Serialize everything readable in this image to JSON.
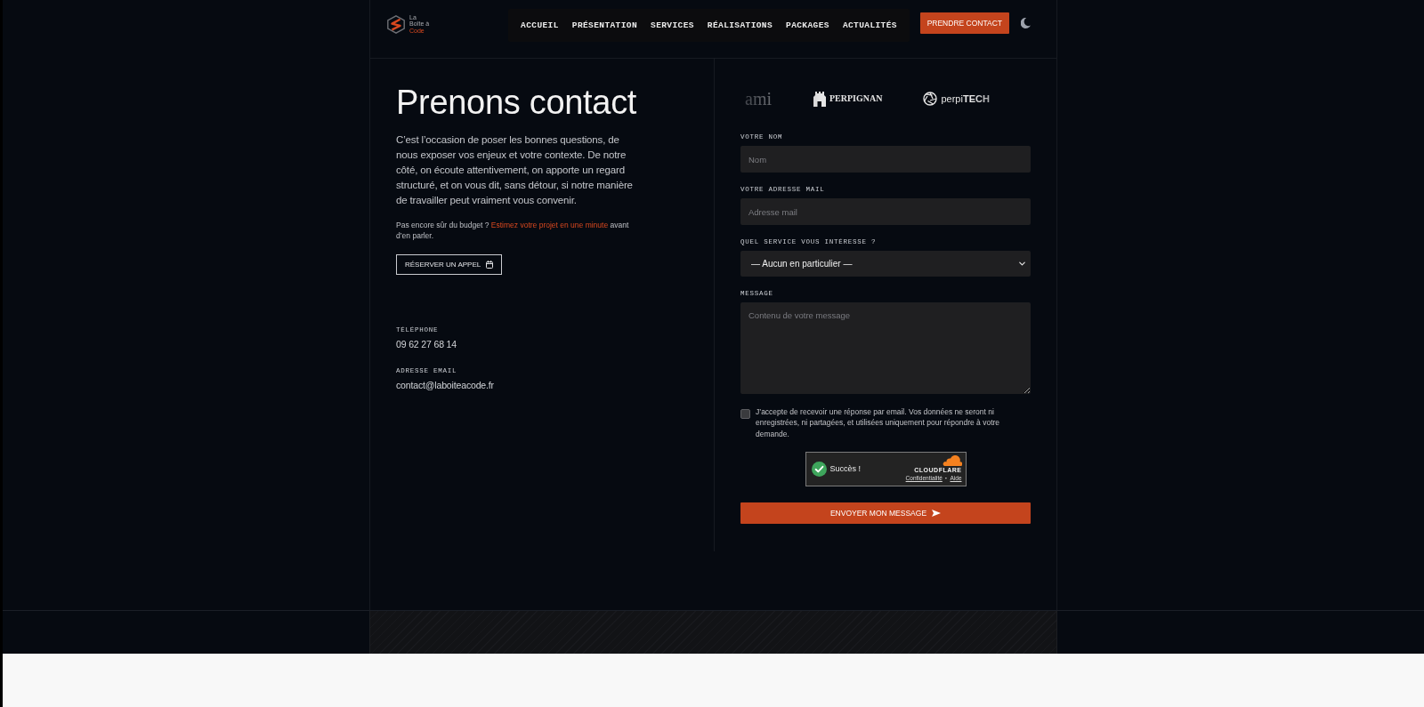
{
  "header": {
    "logo": {
      "lines": [
        "La",
        "Boîte à",
        "Code"
      ]
    },
    "nav": [
      {
        "label": "ACCUEIL",
        "selected": false
      },
      {
        "label": "PRÉSENTATION",
        "selected": false
      },
      {
        "label": "SERVICES",
        "selected": false
      },
      {
        "label": "RÉALISATIONS",
        "selected": false
      },
      {
        "label": "PACKAGES",
        "selected": false
      },
      {
        "label": "ACTUALITÉS",
        "selected": false
      }
    ],
    "cta": "PRENDRE CONTACT"
  },
  "intro": {
    "title": "Prenons contact",
    "text": "C’est l’occasion de poser les bonnes questions, de nous exposer vos enjeux et votre contexte. De notre côté, on écoute attentivement, on apporte un regard structuré, et on vous dit, sans détour, si notre manière de travailler peut vraiment vous convenir.",
    "budget_note": {
      "before": "Pas encore sûr du budget ?",
      "link": "Estimez votre projet en une minute",
      "after": "avant d’en parler."
    },
    "call_button": "RÉSERVER UN APPEL"
  },
  "contact": [
    {
      "label": "TÉLÉPHONE",
      "value": "09 62 27 68 14"
    },
    {
      "label": "ADRESSE EMAIL",
      "value": "contact@laboiteacode.fr"
    }
  ],
  "partners": [
    {
      "kind": "plain",
      "name": "ami"
    },
    {
      "kind": "tower",
      "name": "PERPIGNAN"
    },
    {
      "kind": "aperture",
      "name": "perpi**TECH**"
    }
  ],
  "form": {
    "fields": [
      {
        "kind": "input",
        "label": "VOTRE NOM",
        "placeholder": "Nom"
      },
      {
        "kind": "input",
        "label": "VOTRE ADRESSE MAIL",
        "placeholder": "Adresse mail"
      },
      {
        "kind": "select",
        "label": "QUEL SERVICE VOUS INTÉRESSE ?",
        "value": "— Aucun en particulier —"
      },
      {
        "kind": "textarea",
        "label": "MESSAGE",
        "placeholder": "Contenu de votre message"
      }
    ],
    "consent": {
      "checked": false,
      "text": "J’accepte de recevoir une réponse par email. Vos données ne seront ni enregistrées, ni partagées, et utilisées uniquement pour répondre à votre demande."
    },
    "captcha": {
      "status": "Succès !",
      "brand": "CLOUDFLARE",
      "links": [
        "Confidentialité",
        "Aide"
      ],
      "separator": "·"
    },
    "submit": "ENVOYER MON MESSAGE"
  }
}
